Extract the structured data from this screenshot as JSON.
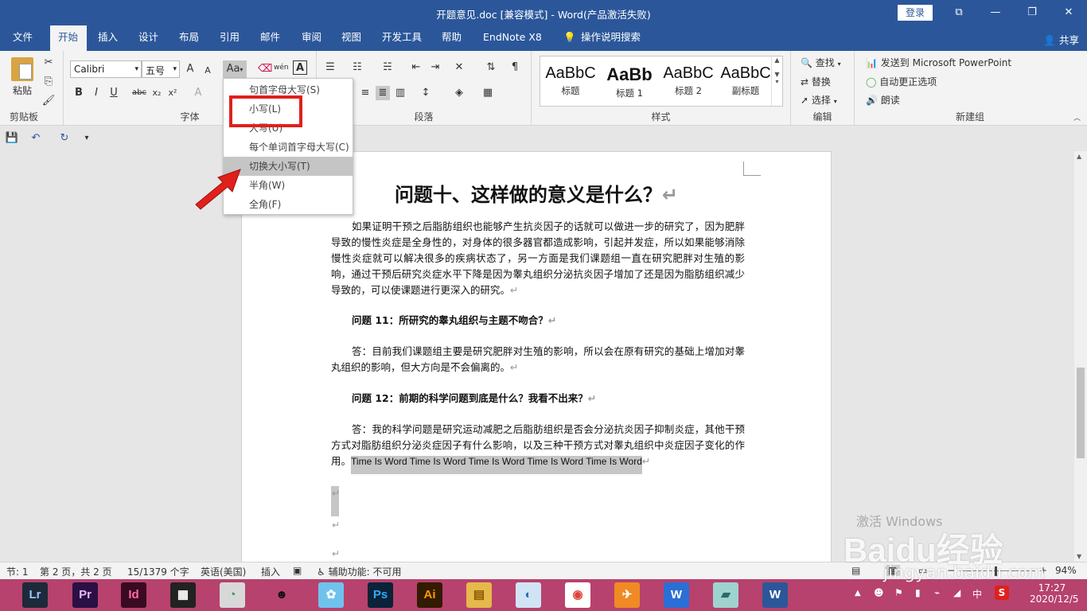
{
  "titlebar": {
    "title": "开题意见.doc [兼容模式]  -  Word(产品激活失败)",
    "login": "登录",
    "restore_glyph": "⧉",
    "min_glyph": "—",
    "max_glyph": "❐",
    "close_glyph": "✕"
  },
  "tabs": [
    "文件",
    "开始",
    "插入",
    "设计",
    "布局",
    "引用",
    "邮件",
    "审阅",
    "视图",
    "开发工具",
    "帮助",
    "EndNote X8",
    "操作说明搜索"
  ],
  "share": "共享",
  "ribbon": {
    "clipboard": {
      "paste": "粘贴",
      "label": "剪贴板"
    },
    "font": {
      "name": "Calibri",
      "size": "五号",
      "label": "字体",
      "aa": "Aa",
      "wen": "wén",
      "bold": "B",
      "italic": "I",
      "underline": "U",
      "strike": "abc",
      "sub": "x₂",
      "sup": "x²",
      "grow": "A",
      "shrink": "A",
      "boxA": "A"
    },
    "paragraph": {
      "label": "段落"
    },
    "styles": {
      "label": "样式",
      "items": [
        {
          "sample": "AaBbC",
          "name": "标题"
        },
        {
          "sample": "AaBb",
          "name": "标题 1"
        },
        {
          "sample": "AaBbC",
          "name": "标题 2"
        },
        {
          "sample": "AaBbC",
          "name": "副标题"
        }
      ]
    },
    "editing": {
      "label": "编辑",
      "find": "查找",
      "replace": "替换",
      "select": "选择"
    },
    "newgroup": {
      "label": "新建组",
      "ppt": "发送到 Microsoft PowerPoint",
      "autocorrect": "自动更正选项",
      "read": "朗读"
    }
  },
  "menu": {
    "items": [
      "句首字母大写(S)",
      "小写(L)",
      "大写(U)",
      "每个单词首字母大写(C)",
      "切换大小写(T)",
      "半角(W)",
      "全角(F)"
    ]
  },
  "document": {
    "title": "问题十、这样做的意义是什么？",
    "p1": "如果证明干预之后脂肪组织也能够产生抗炎因子的话就可以做进一步的研究了，因为肥胖导致的慢性炎症是全身性的，对身体的很多器官都造成影响，引起并发症，所以如果能够消除慢性炎症就可以解决很多的疾病状态了，另一方面是我们课题组一直在研究肥胖对生殖的影响，通过干预后研究炎症水平下降是因为睾丸组织分泌抗炎因子增加了还是因为脂肪组织减少导致的，可以使课题进行更深入的研究。",
    "q11": "问题 11：所研究的睾丸组织与主题不吻合？",
    "a11": "答：目前我们课题组主要是研究肥胖对生殖的影响，所以会在原有研究的基础上增加对睾丸组织的影响，但大方向是不会偏离的。",
    "q12": "问题 12：前期的科学问题到底是什么？我看不出来？",
    "a12": "答：我的科学问题是研究运动减肥之后脂肪组织是否会分泌抗炎因子抑制炎症，其他干预方式对脂肪组织分泌炎症因子有什么影响，以及三种干预方式对睾丸组织中炎症因子变化的作用。",
    "selected": "Time Is Word Time Is Word Time Is Word Time Is Word Time Is Word",
    "return_mark": "↵"
  },
  "statusbar": {
    "section": "节: 1",
    "page": "第 2 页，共 2 页",
    "words": "15/1379 个字",
    "lang": "英语(美国)",
    "mode": "插入",
    "access": "辅助功能: 不可用",
    "zoom": "94%"
  },
  "taskbar": {
    "apps": [
      {
        "label": "Lr",
        "color": "#1d2a3a",
        "fg": "#9ac6ff"
      },
      {
        "label": "Pr",
        "color": "#2a1045",
        "fg": "#e6b8ff"
      },
      {
        "label": "Id",
        "color": "#3a0a22",
        "fg": "#ff6aa6"
      },
      {
        "label": "▦",
        "color": "#222222",
        "fg": "#ffffff"
      },
      {
        "label": "◔",
        "color": "#d8d8d8",
        "fg": "#1aa147"
      },
      {
        "label": "☻",
        "color": "#b7426d",
        "fg": "#111111"
      },
      {
        "label": "✿",
        "color": "#6fc2ee",
        "fg": "#ffffff"
      },
      {
        "label": "Ps",
        "color": "#0b2238",
        "fg": "#31a8ff"
      },
      {
        "label": "Ai",
        "color": "#331b00",
        "fg": "#ff9a00"
      },
      {
        "label": "▤",
        "color": "#e5b94a",
        "fg": "#8a5a00"
      },
      {
        "label": "◐",
        "color": "#d0e4f5",
        "fg": "#2b6db5"
      },
      {
        "label": "◉",
        "color": "#ffffff",
        "fg": "#db4437"
      },
      {
        "label": "✈",
        "color": "#f08a24",
        "fg": "#ffffff"
      },
      {
        "label": "W",
        "color": "#2a6fd6",
        "fg": "#ffffff"
      },
      {
        "label": "▰",
        "color": "#9fd3d0",
        "fg": "#2b6a6a"
      },
      {
        "label": "W",
        "color": "#2b579a",
        "fg": "#ffffff"
      }
    ],
    "time": "17:27",
    "date": "2020/12/5",
    "ime": "中",
    "ime2": "S"
  },
  "watermark": {
    "text": "Baidu经验",
    "url": "jingyan.baidu.com",
    "activate": "激活 Windows"
  }
}
